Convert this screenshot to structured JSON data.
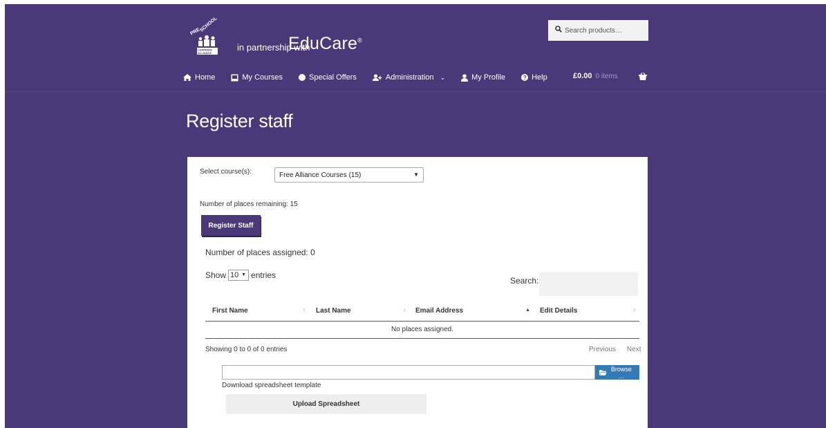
{
  "header": {
    "logo": {
      "preschool_text": "PRE-SCHOOL",
      "alliance_text": "LEARNING ALLIANCE",
      "tagline": "in partnership with",
      "brand": "EduCare"
    },
    "search": {
      "placeholder": "Search products…"
    }
  },
  "nav": {
    "items": [
      {
        "label": "Home",
        "icon": "home-icon"
      },
      {
        "label": "My Courses",
        "icon": "book-icon"
      },
      {
        "label": "Special Offers",
        "icon": "circle-icon"
      },
      {
        "label": "Administration",
        "icon": "users-icon",
        "has_dropdown": true
      },
      {
        "label": "My Profile",
        "icon": "user-icon"
      },
      {
        "label": "Help",
        "icon": "help-icon"
      }
    ],
    "cart": {
      "amount": "£0.00",
      "items": "0 items",
      "icon": "basket-icon"
    }
  },
  "page": {
    "title": "Register staff"
  },
  "form": {
    "select_label": "Select course(s):",
    "selected_course": "Free Alliance Courses (15)",
    "places_remaining": "Number of places remaining: 15",
    "register_button": "Register Staff",
    "places_assigned": "Number of places assigned: 0"
  },
  "table": {
    "show_label": "Show",
    "length_value": "10",
    "entries_label": "entries",
    "search_label": "Search:",
    "columns": [
      "First Name",
      "Last Name",
      "Email Address",
      "Edit Details"
    ],
    "sorted_column": "Email Address",
    "empty_message": "No places assigned.",
    "info": "Showing 0 to 0 of 0 entries",
    "previous": "Previous",
    "next": "Next"
  },
  "upload": {
    "browse_label": "Browse …",
    "download_link": "Download spreadsheet template",
    "upload_button": "Upload Spreadsheet"
  },
  "colors": {
    "brand_purple": "#4a3878",
    "browse_blue": "#337ab7"
  }
}
